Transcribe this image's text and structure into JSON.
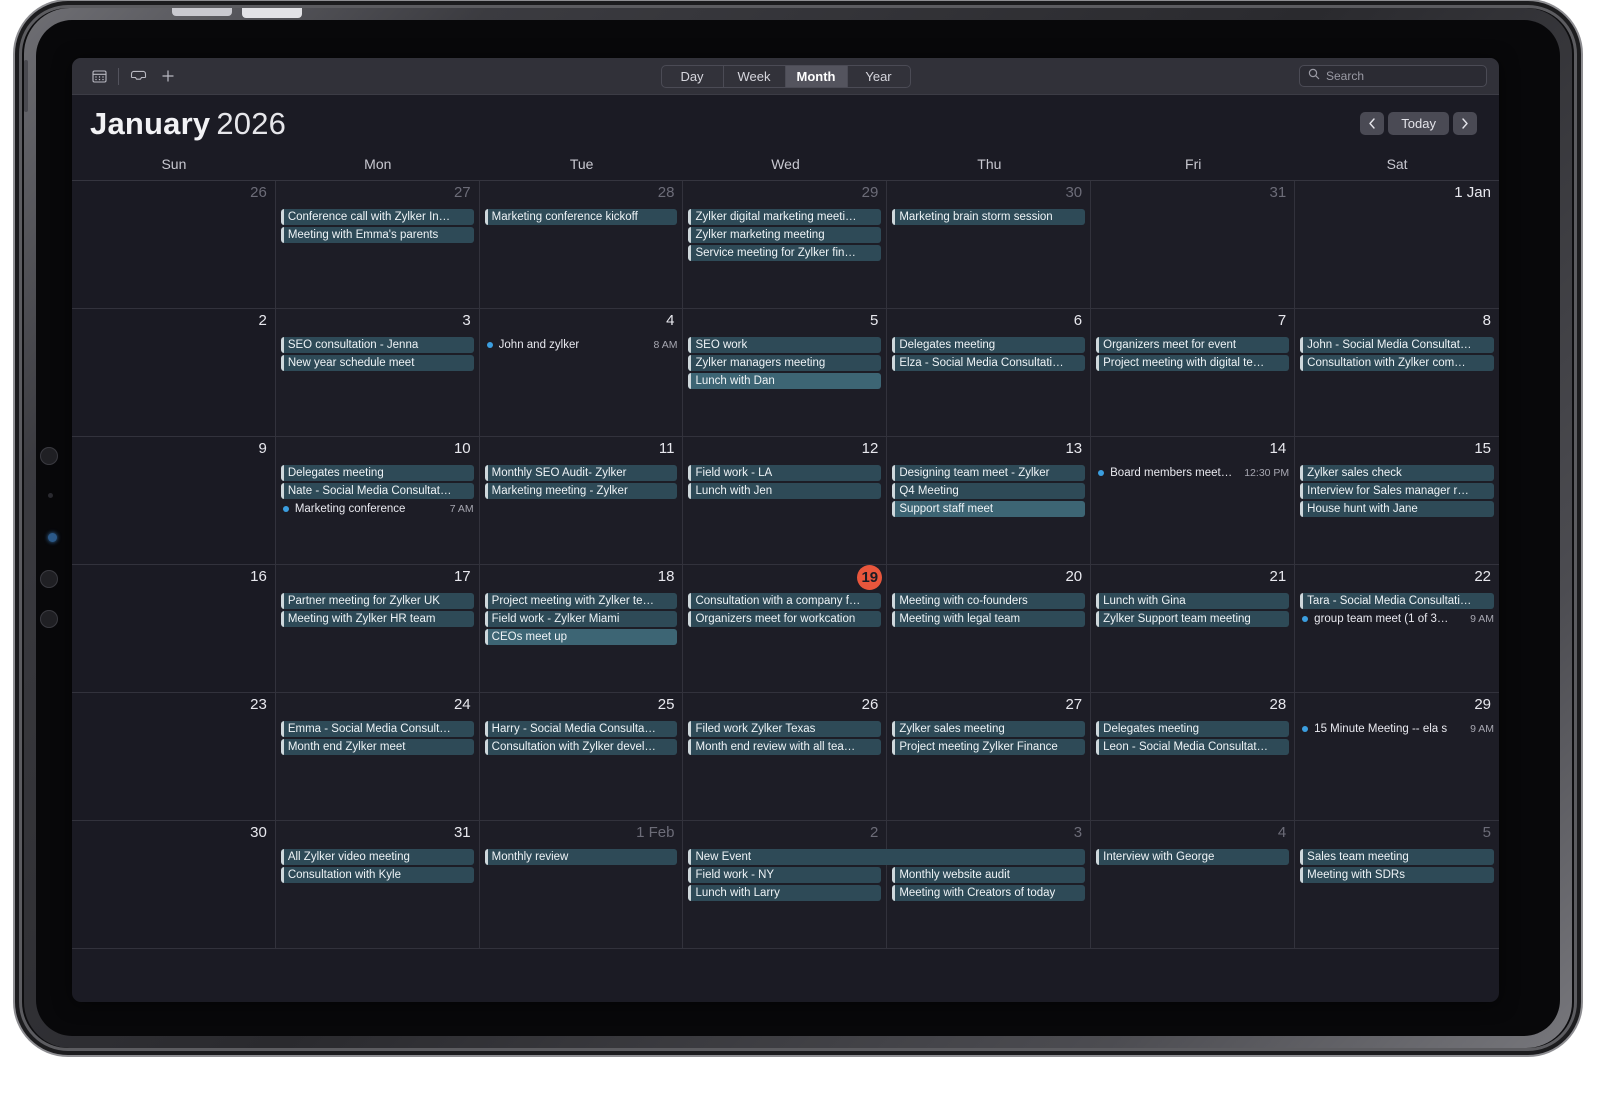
{
  "toolbar": {
    "icons": [
      {
        "name": "calendar-icon",
        "glyph": "calendar"
      },
      {
        "name": "inbox-icon",
        "glyph": "inbox"
      },
      {
        "name": "add-icon",
        "glyph": "plus"
      }
    ],
    "views": [
      {
        "label": "Day",
        "active": false
      },
      {
        "label": "Week",
        "active": false
      },
      {
        "label": "Month",
        "active": true
      },
      {
        "label": "Year",
        "active": false
      }
    ],
    "search": {
      "placeholder": "Search",
      "value": "",
      "icon": "search-icon"
    }
  },
  "header": {
    "month": "January",
    "year": "2026",
    "prev_label": "‹",
    "today_label": "Today",
    "next_label": "›"
  },
  "weekdays": [
    "Sun",
    "Mon",
    "Tue",
    "Wed",
    "Thu",
    "Fri",
    "Sat"
  ],
  "colors": {
    "window_bg": "#1b1b24",
    "cell_bg": "#1d1d26",
    "grid_line": "#32323c",
    "event_bg": "#2e4a57",
    "event_bg_bright": "#3d6574",
    "event_accent": "#cfd8dc",
    "today_badge": "#e8563c",
    "dot_blue": "#3b9ee0",
    "toolbar_bg": "#313139"
  },
  "days": [
    {
      "num": "26",
      "other": true,
      "events": []
    },
    {
      "num": "27",
      "other": true,
      "events": [
        {
          "title": "Conference call with Zylker In…",
          "style": "chip"
        },
        {
          "title": "Meeting with Emma's parents",
          "style": "chip"
        }
      ]
    },
    {
      "num": "28",
      "other": true,
      "events": [
        {
          "title": "Marketing conference kickoff",
          "style": "chip"
        }
      ]
    },
    {
      "num": "29",
      "other": true,
      "events": [
        {
          "title": "Zylker digital marketing meeti…",
          "style": "chip"
        },
        {
          "title": "Zylker marketing meeting",
          "style": "chip"
        },
        {
          "title": "Service meeting for Zylker fin…",
          "style": "chip"
        }
      ]
    },
    {
      "num": "30",
      "other": true,
      "events": [
        {
          "title": "Marketing brain storm session",
          "style": "chip"
        }
      ]
    },
    {
      "num": "31",
      "other": true,
      "events": []
    },
    {
      "num": "1 Jan",
      "other": false,
      "events": []
    },
    {
      "num": "2",
      "other": false,
      "events": []
    },
    {
      "num": "3",
      "other": false,
      "events": [
        {
          "title": "SEO consultation - Jenna",
          "style": "chip"
        },
        {
          "title": "New year schedule meet",
          "style": "chip"
        }
      ]
    },
    {
      "num": "4",
      "other": false,
      "events": [
        {
          "title": "John and zylker",
          "style": "dot",
          "time": "8 AM"
        }
      ]
    },
    {
      "num": "5",
      "other": false,
      "events": [
        {
          "title": "SEO work",
          "style": "chip"
        },
        {
          "title": "Zylker managers meeting",
          "style": "chip"
        },
        {
          "title": "Lunch with Dan",
          "style": "chip-bright"
        }
      ]
    },
    {
      "num": "6",
      "other": false,
      "events": [
        {
          "title": "Delegates meeting",
          "style": "chip"
        },
        {
          "title": "Elza - Social Media Consultati…",
          "style": "chip"
        }
      ]
    },
    {
      "num": "7",
      "other": false,
      "events": [
        {
          "title": "Organizers meet for event",
          "style": "chip"
        },
        {
          "title": "Project meeting with digital te…",
          "style": "chip"
        }
      ]
    },
    {
      "num": "8",
      "other": false,
      "events": [
        {
          "title": "John - Social Media Consultat…",
          "style": "chip"
        },
        {
          "title": "Consultation with Zylker com…",
          "style": "chip"
        }
      ]
    },
    {
      "num": "9",
      "other": false,
      "events": []
    },
    {
      "num": "10",
      "other": false,
      "events": [
        {
          "title": "Delegates meeting",
          "style": "chip"
        },
        {
          "title": "Nate - Social Media Consultat…",
          "style": "chip"
        },
        {
          "title": "Marketing conference",
          "style": "dot",
          "time": "7 AM"
        }
      ]
    },
    {
      "num": "11",
      "other": false,
      "events": [
        {
          "title": "Monthly SEO Audit- Zylker",
          "style": "chip"
        },
        {
          "title": "Marketing meeting - Zylker",
          "style": "chip"
        }
      ]
    },
    {
      "num": "12",
      "other": false,
      "events": [
        {
          "title": "Field work - LA",
          "style": "chip"
        },
        {
          "title": "Lunch with Jen",
          "style": "chip"
        }
      ]
    },
    {
      "num": "13",
      "other": false,
      "events": [
        {
          "title": "Designing team meet - Zylker",
          "style": "chip"
        },
        {
          "title": "Q4 Meeting",
          "style": "chip"
        },
        {
          "title": "Support staff meet",
          "style": "chip-bright"
        }
      ]
    },
    {
      "num": "14",
      "other": false,
      "events": [
        {
          "title": "Board members meet…",
          "style": "dot",
          "time": "12:30 PM"
        }
      ]
    },
    {
      "num": "15",
      "other": false,
      "events": [
        {
          "title": "Zylker sales check",
          "style": "chip"
        },
        {
          "title": "Interview for Sales manager r…",
          "style": "chip"
        },
        {
          "title": "House hunt with Jane",
          "style": "chip"
        }
      ]
    },
    {
      "num": "16",
      "other": false,
      "events": []
    },
    {
      "num": "17",
      "other": false,
      "events": [
        {
          "title": "Partner meeting for Zylker UK",
          "style": "chip"
        },
        {
          "title": "Meeting with Zylker HR team",
          "style": "chip"
        }
      ]
    },
    {
      "num": "18",
      "other": false,
      "events": [
        {
          "title": "Project meeting with Zylker te…",
          "style": "chip"
        },
        {
          "title": "Field work - Zylker Miami",
          "style": "chip"
        },
        {
          "title": "CEOs meet up",
          "style": "chip-bright"
        }
      ]
    },
    {
      "num": "19",
      "other": false,
      "today": true,
      "events": [
        {
          "title": "Consultation with a company f…",
          "style": "chip"
        },
        {
          "title": "Organizers meet for workcation",
          "style": "chip"
        }
      ]
    },
    {
      "num": "20",
      "other": false,
      "events": [
        {
          "title": "Meeting with co-founders",
          "style": "chip"
        },
        {
          "title": "Meeting with legal team",
          "style": "chip"
        }
      ]
    },
    {
      "num": "21",
      "other": false,
      "events": [
        {
          "title": "Lunch with Gina",
          "style": "chip"
        },
        {
          "title": "Zylker Support team meeting",
          "style": "chip"
        }
      ]
    },
    {
      "num": "22",
      "other": false,
      "events": [
        {
          "title": "Tara - Social Media Consultati…",
          "style": "chip"
        },
        {
          "title": "group team meet (1 of 3…",
          "style": "dot",
          "time": "9 AM"
        }
      ]
    },
    {
      "num": "23",
      "other": false,
      "events": []
    },
    {
      "num": "24",
      "other": false,
      "events": [
        {
          "title": "Emma - Social Media Consult…",
          "style": "chip"
        },
        {
          "title": "Month end Zylker meet",
          "style": "chip"
        }
      ]
    },
    {
      "num": "25",
      "other": false,
      "events": [
        {
          "title": "Harry - Social Media Consulta…",
          "style": "chip"
        },
        {
          "title": "Consultation with Zylker devel…",
          "style": "chip"
        }
      ]
    },
    {
      "num": "26",
      "other": false,
      "events": [
        {
          "title": "Filed work Zylker Texas",
          "style": "chip"
        },
        {
          "title": "Month end review with all tea…",
          "style": "chip"
        }
      ]
    },
    {
      "num": "27",
      "other": false,
      "events": [
        {
          "title": "Zylker sales meeting",
          "style": "chip"
        },
        {
          "title": "Project meeting Zylker Finance",
          "style": "chip"
        }
      ]
    },
    {
      "num": "28",
      "other": false,
      "events": [
        {
          "title": "Delegates meeting",
          "style": "chip"
        },
        {
          "title": "Leon - Social Media Consultat…",
          "style": "chip"
        }
      ]
    },
    {
      "num": "29",
      "other": false,
      "events": [
        {
          "title": "15 Minute Meeting -- ela s",
          "style": "dot",
          "time": "9 AM"
        }
      ]
    },
    {
      "num": "30",
      "other": false,
      "events": []
    },
    {
      "num": "31",
      "other": false,
      "events": [
        {
          "title": "All Zylker video meeting",
          "style": "chip"
        },
        {
          "title": "Consultation with Kyle",
          "style": "chip"
        }
      ]
    },
    {
      "num": "1 Feb",
      "other": true,
      "events": [
        {
          "title": "Monthly review",
          "style": "chip"
        }
      ]
    },
    {
      "num": "2",
      "other": true,
      "events": [
        {
          "title": "New Event",
          "style": "chip-span2"
        },
        {
          "title": "Field work - NY",
          "style": "chip"
        },
        {
          "title": "Lunch with Larry",
          "style": "chip"
        }
      ]
    },
    {
      "num": "3",
      "other": true,
      "events": [
        {
          "title": "",
          "style": "spacer"
        },
        {
          "title": "Monthly website audit",
          "style": "chip"
        },
        {
          "title": "Meeting with Creators of today",
          "style": "chip"
        }
      ]
    },
    {
      "num": "4",
      "other": true,
      "events": [
        {
          "title": "Interview with George",
          "style": "chip"
        }
      ]
    },
    {
      "num": "5",
      "other": true,
      "events": [
        {
          "title": "Sales team meeting",
          "style": "chip"
        },
        {
          "title": "Meeting with SDRs",
          "style": "chip"
        }
      ]
    }
  ]
}
